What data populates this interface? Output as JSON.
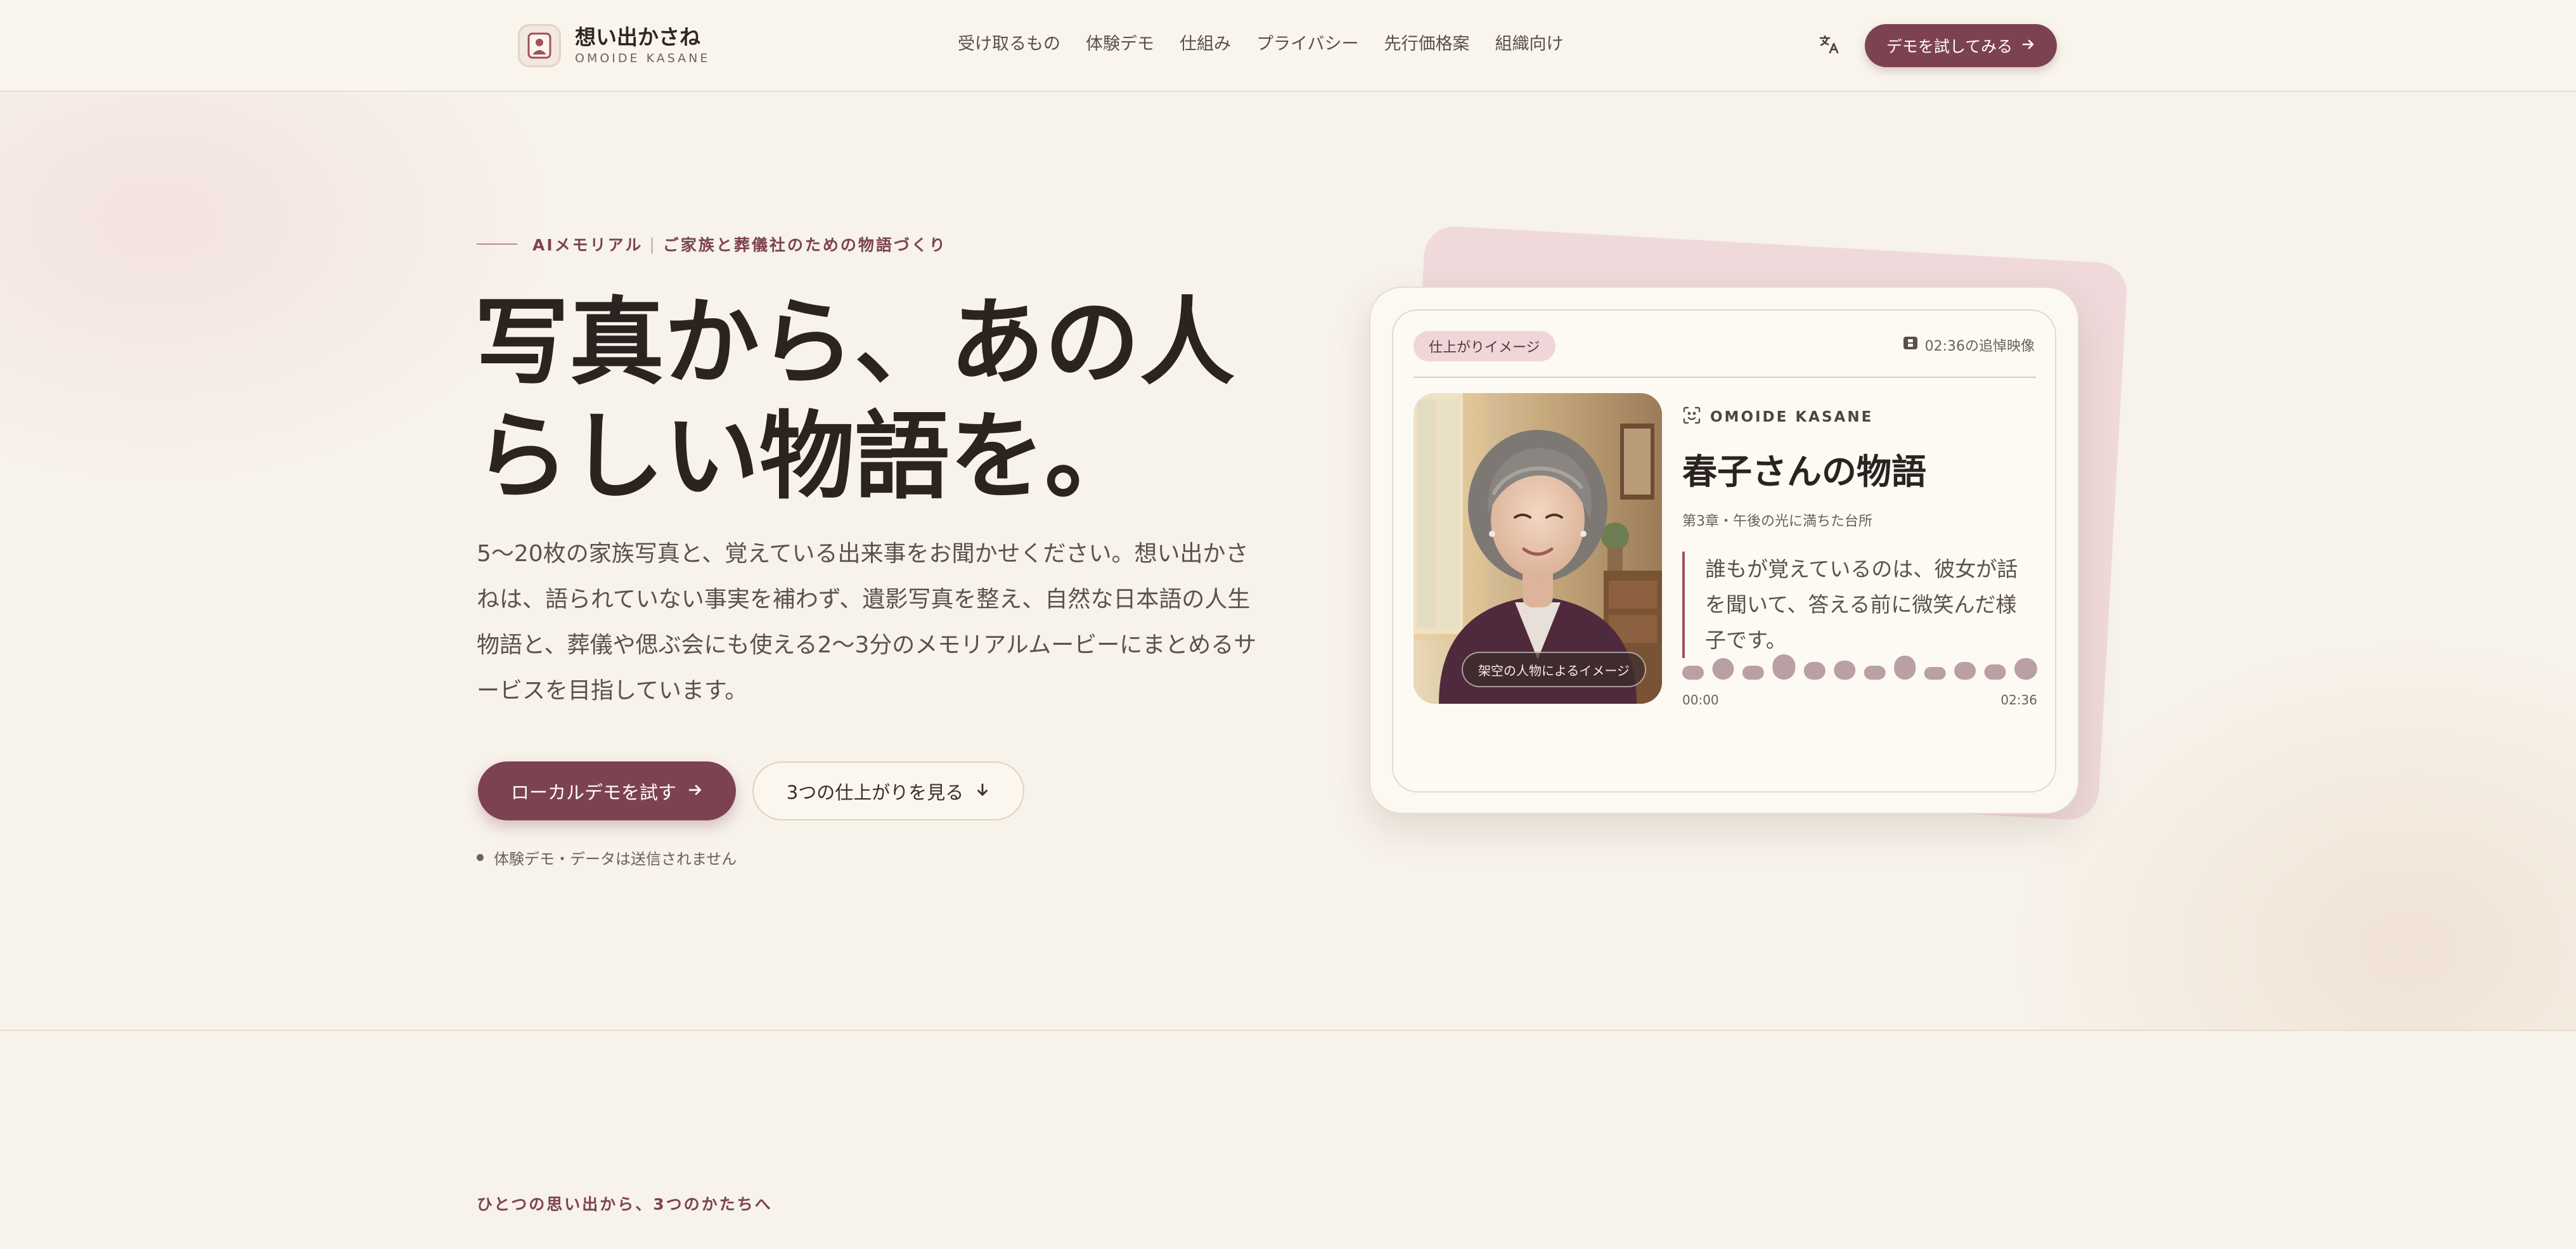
{
  "header": {
    "brand_name": "想い出かさね",
    "brand_sub": "OMOIDE KASANE",
    "nav": [
      "受け取るもの",
      "体験デモ",
      "仕組み",
      "プライバシー",
      "先行価格案",
      "組織向け"
    ],
    "cta_label": "デモを試してみる"
  },
  "hero": {
    "eyebrow_main": "AIメモリアル",
    "eyebrow_sep": "|",
    "eyebrow_sub": "ご家族と葬儀社のための物語づくり",
    "headline_line1": "写真から、あの人",
    "headline_line2": "らしい物語を。",
    "lead": "5〜20枚の家族写真と、覚えている出来事をお聞かせください。想い出かさねは、語られていない事実を補わず、遺影写真を整え、自然な日本語の人生物語と、葬儀や偲ぶ会にも使える2〜3分のメモリアルムービーにまとめるサービスを目指しています。",
    "primary_button": "ローカルデモを試す",
    "secondary_button": "3つの仕上がりを見る",
    "note": "体験デモ・データは送信されません"
  },
  "card": {
    "badge": "仕上がりイメージ",
    "duration": "02:36の追悼映像",
    "photo_label": "架空の人物によるイメージ",
    "brand": "OMOIDE KASANE",
    "title": "春子さんの物語",
    "chapter": "第3章・午後の光に満ちた台所",
    "quote": "誰もが覚えているのは、彼女が話を聞いて、答える前に微笑んだ様子です。",
    "time_start": "00:00",
    "time_end": "02:36"
  },
  "section2": {
    "eyebrow": "ひとつの思い出から、3つのかたちへ"
  },
  "colors": {
    "accent": "#7d4252",
    "card_back": "#efd9da",
    "waveform": "#b8a0a4"
  }
}
